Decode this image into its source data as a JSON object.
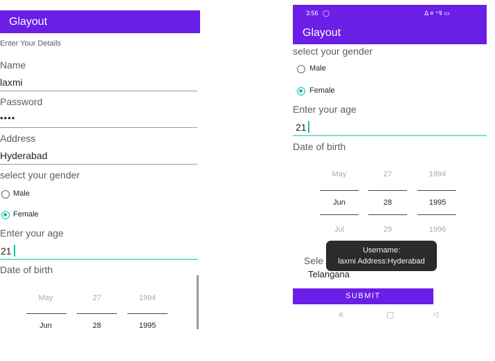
{
  "app_title": "Glayout",
  "left": {
    "header": "Enter Your Details",
    "name_label": "Name",
    "name_value": "laxmi",
    "password_label": "Password",
    "password_value": "••••",
    "address_label": "Address",
    "address_value": "Hyderabad",
    "gender_label": "select your gender",
    "male_label": "Male",
    "female_label": "Female",
    "age_label": "Enter your age",
    "age_value": "21",
    "dob_label": "Date of birth",
    "picker_top": [
      "May",
      "27",
      "1994"
    ],
    "picker_selected": [
      "Jun",
      "28",
      "1995"
    ]
  },
  "right": {
    "status_time": "3:56",
    "status_icons": "Δ ≡ ⁺ˡ‖ ▭",
    "gender_label": "select your gender",
    "male_label": "Male",
    "female_label": "Female",
    "age_label": "Enter your age",
    "age_value": "21",
    "dob_label": "Date of birth",
    "picker_top": [
      "May",
      "27",
      "1994"
    ],
    "picker_selected": [
      "Jun",
      "28",
      "1995"
    ],
    "picker_bottom": [
      "Jul",
      "29",
      "1996"
    ],
    "state_label_partial": "Sele",
    "state_value": "Telangana",
    "toast_line1": "Username:",
    "toast_line2": "laxmi Address:Hyderabad",
    "submit_label": "SUBMIT",
    "nav_icons": [
      "≡",
      "▢",
      "◁"
    ]
  },
  "colors": {
    "primary": "#6a1ee6",
    "accent": "#0fbfaa"
  }
}
